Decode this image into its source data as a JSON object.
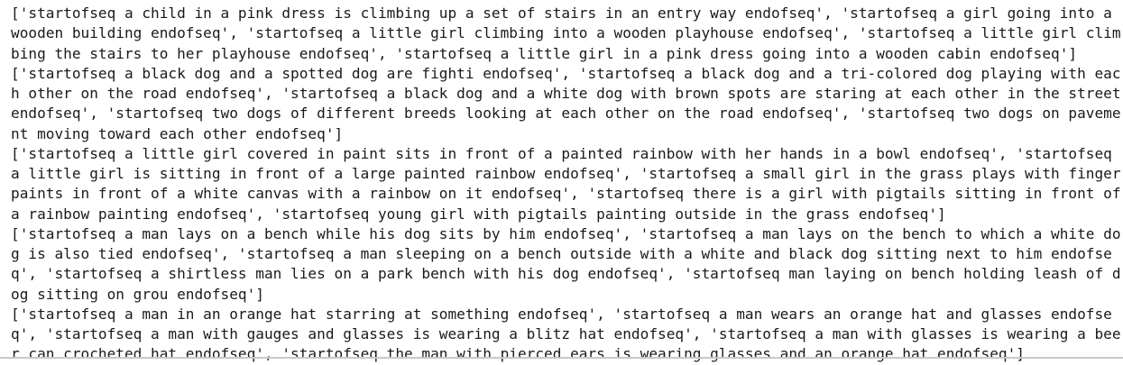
{
  "output": {
    "lines": [
      "['startofseq a child in a pink dress is climbing up a set of stairs in an entry way endofseq', 'startofseq a girl going into a",
      "wooden building endofseq', 'startofseq a little girl climbing into a wooden playhouse endofseq', 'startofseq a little girl clim",
      "bing the stairs to her playhouse endofseq', 'startofseq a little girl in a pink dress going into a wooden cabin endofseq']",
      "['startofseq a black dog and a spotted dog are fighti endofseq', 'startofseq a black dog and a tri-colored dog playing with eac",
      "h other on the road endofseq', 'startofseq a black dog and a white dog with brown spots are staring at each other in the street",
      "endofseq', 'startofseq two dogs of different breeds looking at each other on the road endofseq', 'startofseq two dogs on paveme",
      "nt moving toward each other endofseq']",
      "['startofseq a little girl covered in paint sits in front of a painted rainbow with her hands in a bowl endofseq', 'startofseq",
      "a little girl is sitting in front of a large painted rainbow endofseq', 'startofseq a small girl in the grass plays with finger",
      "paints in front of a white canvas with a rainbow on it endofseq', 'startofseq there is a girl with pigtails sitting in front of",
      "a rainbow painting endofseq', 'startofseq young girl with pigtails painting outside in the grass endofseq']",
      "['startofseq a man lays on a bench while his dog sits by him endofseq', 'startofseq a man lays on the bench to which a white do",
      "g is also tied endofseq', 'startofseq a man sleeping on a bench outside with a white and black dog sitting next to him endofse",
      "q', 'startofseq a shirtless man lies on a park bench with his dog endofseq', 'startofseq man laying on bench holding leash of d",
      "og sitting on grou endofseq']",
      "['startofseq a man in an orange hat starring at something endofseq', 'startofseq a man wears an orange hat and glasses endofse",
      "q', 'startofseq a man with gauges and glasses is wearing a blitz hat endofseq', 'startofseq a man with glasses is wearing a bee",
      "r can crocheted hat endofseq', 'startofseq the man with pierced ears is wearing glasses and an orange hat endofseq']"
    ]
  }
}
